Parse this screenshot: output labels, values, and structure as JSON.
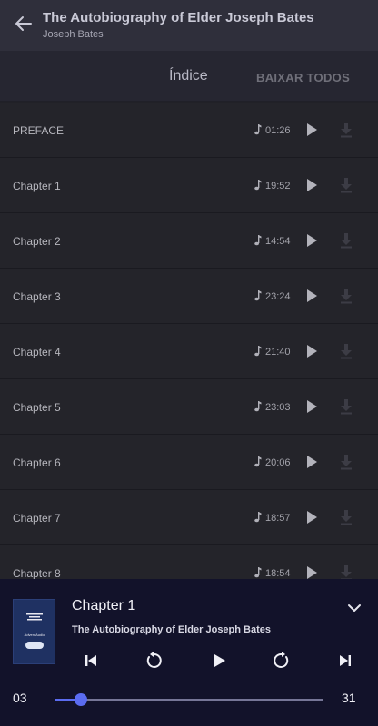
{
  "header": {
    "title": "The Autobiography of Elder Joseph Bates",
    "subtitle": "Joseph Bates",
    "back_icon": "arrow-left-icon"
  },
  "tabs": {
    "index_label": "Índice",
    "download_all_label": "BAIXAR TODOS"
  },
  "chapters": [
    {
      "title": "PREFACE",
      "duration": "01:26"
    },
    {
      "title": "Chapter 1",
      "duration": "19:52"
    },
    {
      "title": "Chapter 2",
      "duration": "14:54"
    },
    {
      "title": "Chapter 3",
      "duration": "23:24"
    },
    {
      "title": "Chapter 4",
      "duration": "21:40"
    },
    {
      "title": "Chapter 5",
      "duration": "23:03"
    },
    {
      "title": "Chapter 6",
      "duration": "20:06"
    },
    {
      "title": "Chapter 7",
      "duration": "18:57"
    },
    {
      "title": "Chapter 8",
      "duration": "18:54"
    }
  ],
  "player": {
    "chapter": "Chapter 1",
    "book": "The Autobiography of Elder Joseph Bates",
    "cover_text": "AdventAudio",
    "elapsed": "03",
    "total": "31",
    "progress_fraction": 0.097
  },
  "colors": {
    "accent": "#5b6cf0",
    "header_bg": "#2f2f3b",
    "list_bg": "#24242a",
    "player_bg": "#12122a"
  }
}
